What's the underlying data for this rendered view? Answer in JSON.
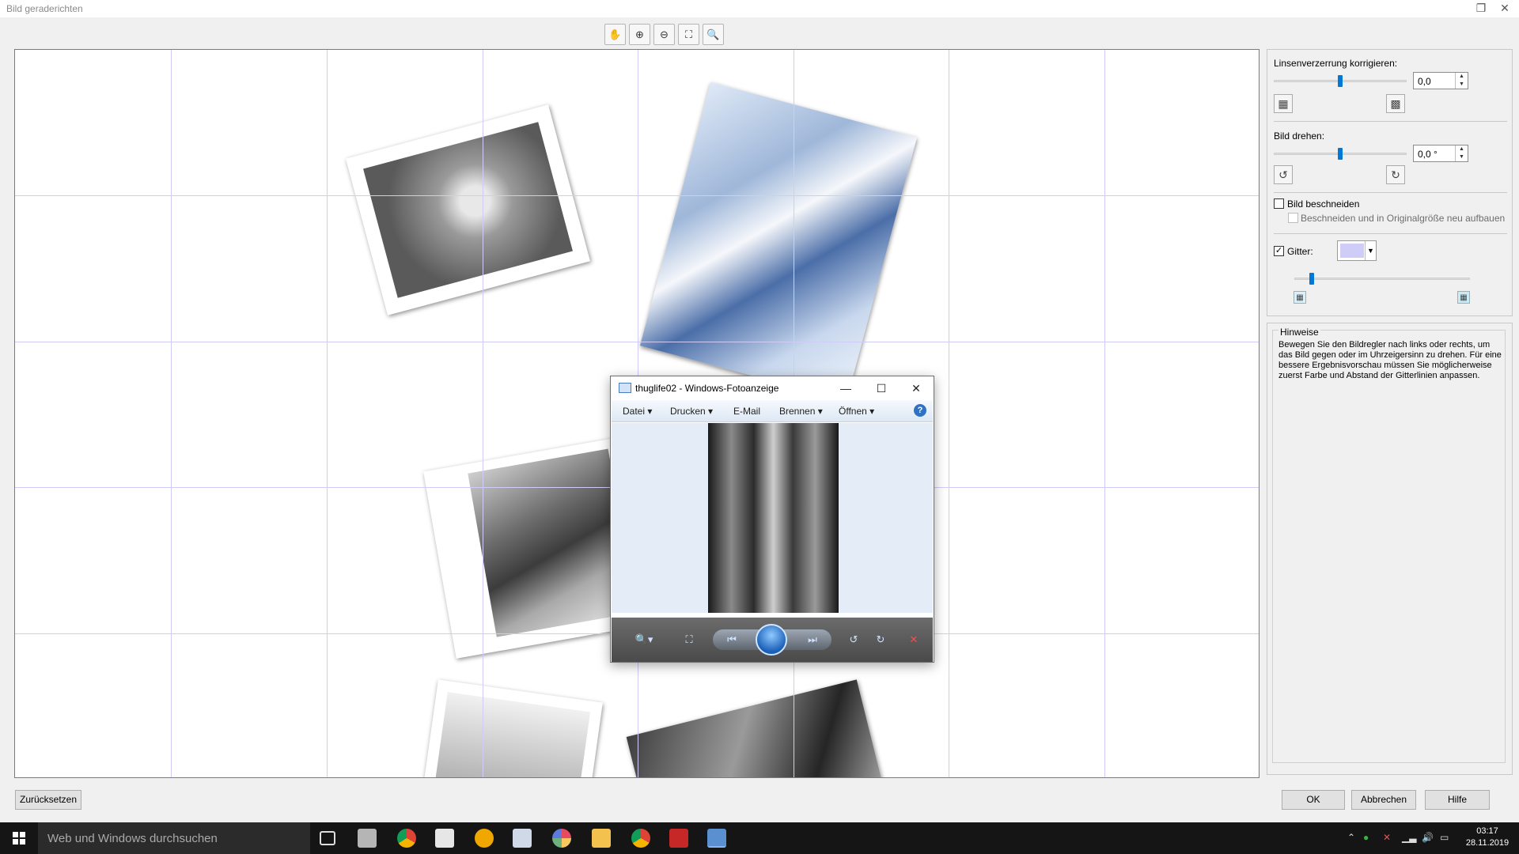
{
  "window": {
    "title": "Bild geraderichten",
    "restore_icon": "restore-icon",
    "close_icon": "close-icon"
  },
  "toolbar": {
    "tools": [
      "hand-icon",
      "zoom-in-icon",
      "zoom-out-icon",
      "fit-to-window-icon",
      "actual-size-icon"
    ]
  },
  "panel": {
    "lens_label": "Linsenverzerrung korrigieren:",
    "lens_value": "0,0",
    "lens_slider_value": 0.5,
    "rotate_label": "Bild drehen:",
    "rotate_value": "0,0 °",
    "rotate_slider_value": 0.5,
    "crop_label": "Bild beschneiden",
    "crop_checked": false,
    "crop_rebuild_label": "Beschneiden und in Originalgröße neu aufbauen",
    "crop_rebuild_checked": false,
    "grid_label": "Gitter:",
    "grid_checked": true,
    "grid_color": "#cfcdf8",
    "grid_spacing_value": 0.1
  },
  "hints": {
    "title": "Hinweise",
    "text": "Bewegen Sie den Bildregler nach links oder rechts, um das Bild gegen oder im Uhrzeigersinn zu drehen. Für eine bessere Ergebnisvorschau müssen Sie möglicherweise zuerst Farbe und Abstand der Gitterlinien anpassen."
  },
  "buttons": {
    "reset": "Zurücksetzen",
    "ok": "OK",
    "cancel": "Abbrechen",
    "help": "Hilfe"
  },
  "popup": {
    "title": "thuglife02 - Windows-Fotoanzeige",
    "menu": [
      "Datei",
      "Drucken",
      "E-Mail",
      "Brennen",
      "Öffnen"
    ],
    "help_icon": "help-icon"
  },
  "taskbar": {
    "search_placeholder": "Web und Windows durchsuchen",
    "time": "03:17",
    "date": "28.11.2019"
  }
}
